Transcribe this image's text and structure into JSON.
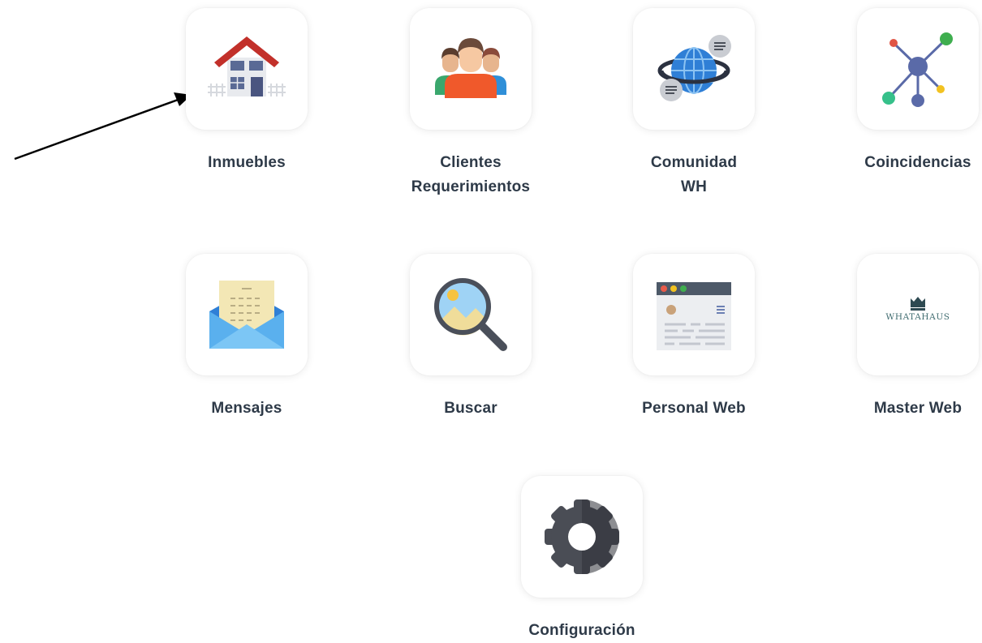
{
  "tiles": [
    {
      "id": "inmuebles",
      "lines": [
        "Inmuebles"
      ],
      "icon": "house-icon"
    },
    {
      "id": "clientes",
      "lines": [
        "Clientes",
        "Requerimientos"
      ],
      "icon": "people-group-icon"
    },
    {
      "id": "comunidad",
      "lines": [
        "Comunidad",
        "WH"
      ],
      "icon": "globe-chat-icon"
    },
    {
      "id": "coincidencias",
      "lines": [
        "Coincidencias"
      ],
      "icon": "network-nodes-icon"
    },
    {
      "id": "mensajes",
      "lines": [
        "Mensajes"
      ],
      "icon": "open-envelope-icon"
    },
    {
      "id": "buscar",
      "lines": [
        "Buscar"
      ],
      "icon": "magnifier-icon"
    },
    {
      "id": "personal-web",
      "lines": [
        "Personal Web"
      ],
      "icon": "browser-window-icon"
    },
    {
      "id": "master-web",
      "lines": [
        "Master Web"
      ],
      "icon": "whatahaus-logo-icon"
    },
    {
      "id": "configuracion",
      "lines": [
        "Configuración"
      ],
      "icon": "gear-icon"
    }
  ],
  "logo_text": "WHATAHAUS",
  "colors": {
    "label": "#2e3a48",
    "card_bg": "#ffffff",
    "arrow": "#000000"
  }
}
